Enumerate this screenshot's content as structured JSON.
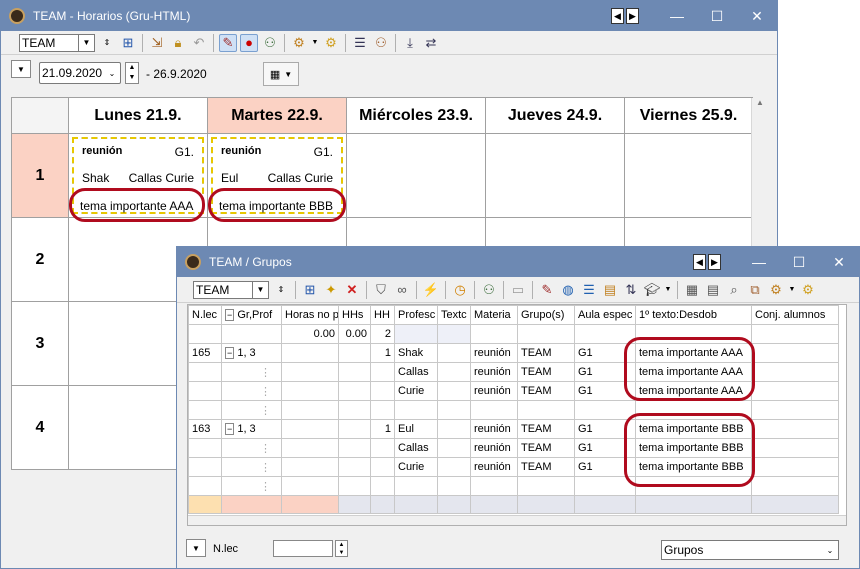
{
  "main_window": {
    "title": "TEAM -   Horarios  (Gru-HTML)",
    "element_combo": "TEAM",
    "date_from": "21.09.2020",
    "date_to": "- 26.9.2020",
    "days": [
      "Lunes 21.9.",
      "Martes 22.9.",
      "Miércoles 23.9.",
      "Jueves 24.9.",
      "Viernes 25.9."
    ],
    "hours": [
      "1",
      "2",
      "3",
      "4"
    ],
    "lessons": [
      {
        "subject": "reunión",
        "group": "G1.",
        "teachers_left": "Shak",
        "teachers_right": "Callas Curie",
        "text": "tema importante AAA"
      },
      {
        "subject": "reunión",
        "group": "G1.",
        "teachers_left": "Eul",
        "teachers_right": "Callas Curie",
        "text": "tema importante BBB"
      }
    ]
  },
  "grupos_window": {
    "title": "TEAM / Grupos",
    "element_combo": "TEAM",
    "columns": [
      "N.lec",
      "Gr,Prof",
      "Horas no p",
      "HHs",
      "HH",
      "Profesc",
      "Textc",
      "Materia",
      "Grupo(s)",
      "Aula espec",
      "1º texto:Desdob",
      "Conj. alumnos"
    ],
    "totals": {
      "horas": "0.00",
      "hhs": "0.00",
      "hh": "2"
    },
    "rows": [
      {
        "nlec": "165",
        "grprof": "1, 3",
        "hh": "1",
        "prof": "Shak",
        "materia": "reunión",
        "grupo": "TEAM",
        "aula": "G1",
        "texto": "tema importante AAA"
      },
      {
        "nlec": "",
        "grprof": "",
        "hh": "",
        "prof": "Callas",
        "materia": "reunión",
        "grupo": "TEAM",
        "aula": "G1",
        "texto": "tema importante AAA"
      },
      {
        "nlec": "",
        "grprof": "",
        "hh": "",
        "prof": "Curie",
        "materia": "reunión",
        "grupo": "TEAM",
        "aula": "G1",
        "texto": "tema importante AAA"
      },
      {
        "nlec": "163",
        "grprof": "1, 3",
        "hh": "1",
        "prof": "Eul",
        "materia": "reunión",
        "grupo": "TEAM",
        "aula": "G1",
        "texto": "tema importante BBB"
      },
      {
        "nlec": "",
        "grprof": "",
        "hh": "",
        "prof": "Callas",
        "materia": "reunión",
        "grupo": "TEAM",
        "aula": "G1",
        "texto": "tema importante BBB"
      },
      {
        "nlec": "",
        "grprof": "",
        "hh": "",
        "prof": "Curie",
        "materia": "reunión",
        "grupo": "TEAM",
        "aula": "G1",
        "texto": "tema importante BBB"
      }
    ],
    "footer_label": "N.lec",
    "footer_select": "Grupos"
  },
  "colors": {
    "titlebar": "#6d89b3",
    "highlight": "#fbd2c4",
    "ring": "#b00b1e"
  }
}
